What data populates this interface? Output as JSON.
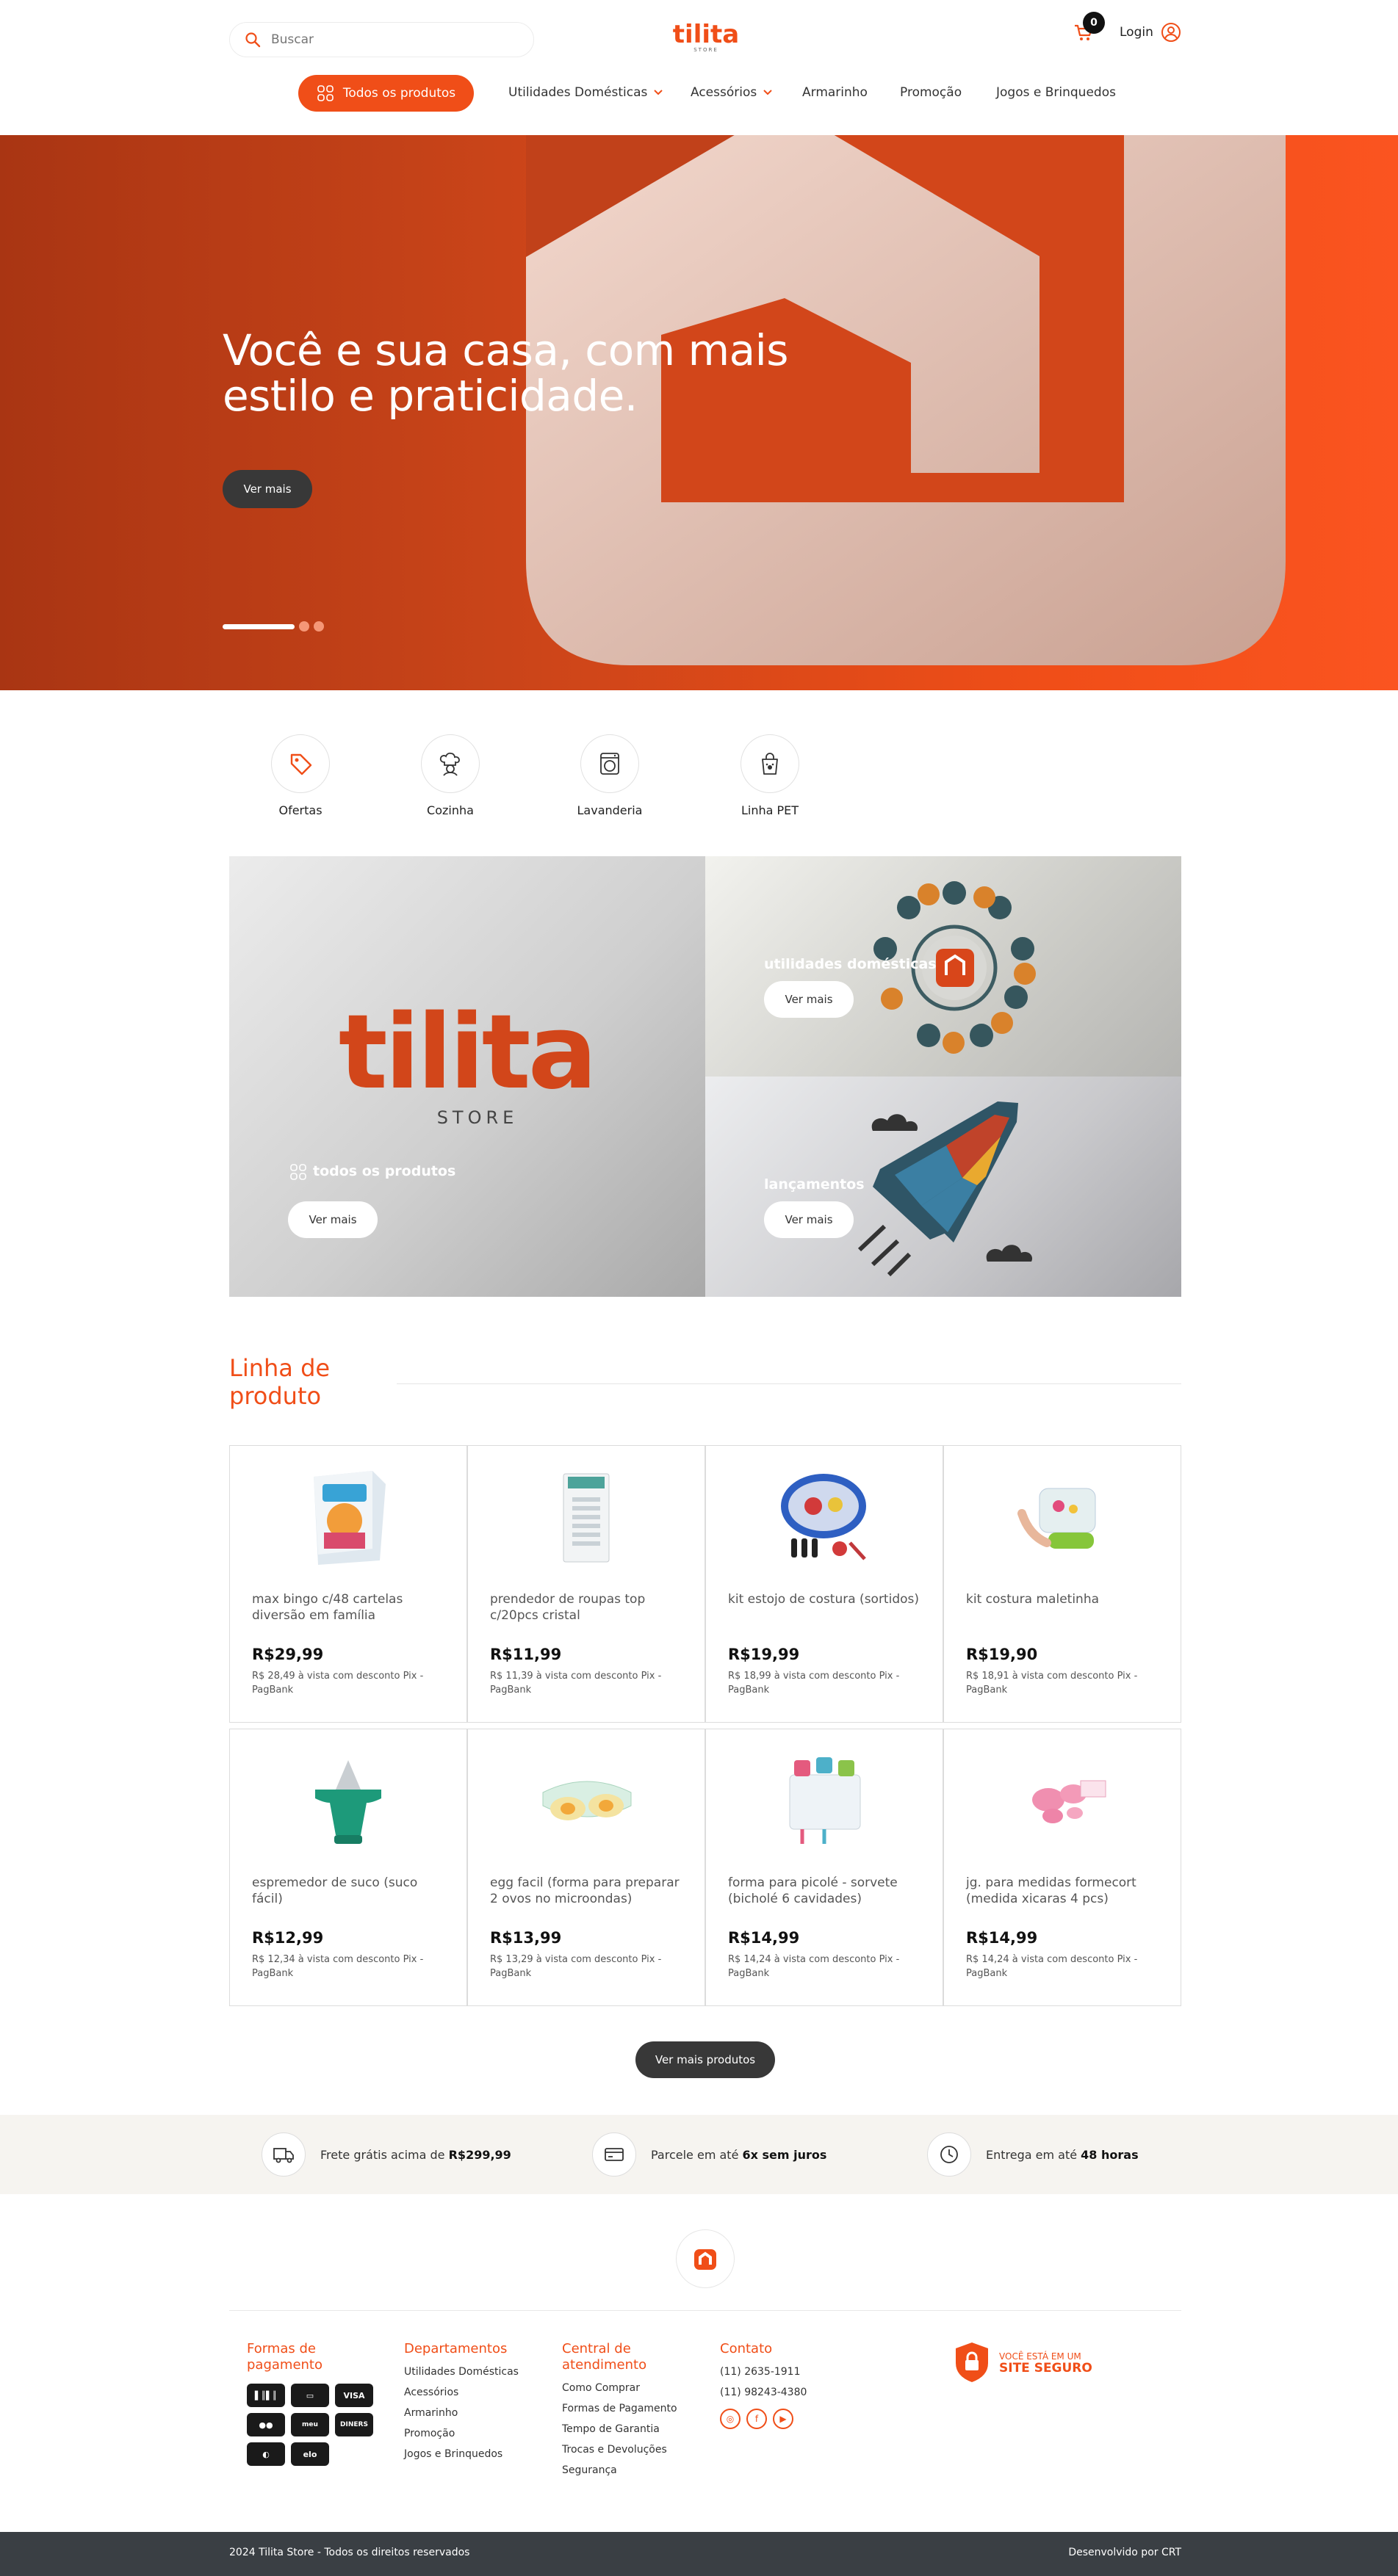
{
  "header": {
    "search_placeholder": "Buscar",
    "cart_count": "0",
    "login_label": "Login"
  },
  "nav": {
    "all_products": "Todos os produtos",
    "items": [
      "Utilidades Domésticas",
      "Acessórios",
      "Armarinho",
      "Promoção",
      "Jogos e Brinquedos"
    ]
  },
  "hero": {
    "title_line1": "Você e sua casa, com mais",
    "title_line2": "estilo e praticidade.",
    "button": "Ver mais"
  },
  "categories": [
    "Ofertas",
    "Cozinha",
    "Lavanderia",
    "Linha PET"
  ],
  "banners": {
    "logo_word": "tilita",
    "logo_sub": "STORE",
    "all_label": "todos os produtos",
    "utilities_label": "utilidades domésticas",
    "launches_label": "lançamentos",
    "button": "Ver mais"
  },
  "product_line": {
    "title_line1": "Linha de",
    "title_line2": "produto",
    "products": [
      {
        "name": "max bingo c/48 cartelas diversão em família",
        "price": "R$29,99",
        "pix": "R$ 28,49 à vista com desconto Pix - PagBank"
      },
      {
        "name": "prendedor de roupas top c/20pcs cristal",
        "price": "R$11,99",
        "pix": "R$ 11,39 à vista com desconto Pix - PagBank"
      },
      {
        "name": "kit estojo de costura (sortidos)",
        "price": "R$19,99",
        "pix": "R$ 18,99 à vista com desconto Pix - PagBank"
      },
      {
        "name": "kit costura maletinha",
        "price": "R$19,90",
        "pix": "R$ 18,91 à vista com desconto Pix - PagBank"
      },
      {
        "name": "espremedor de suco (suco fácil)",
        "price": "R$12,99",
        "pix": "R$ 12,34 à vista com desconto Pix - PagBank"
      },
      {
        "name": "egg facil (forma para preparar 2 ovos no microondas)",
        "price": "R$13,99",
        "pix": "R$ 13,29 à vista com desconto Pix - PagBank"
      },
      {
        "name": "forma para picolé - sorvete (bicholé 6 cavidades)",
        "price": "R$14,99",
        "pix": "R$ 14,24 à vista com desconto Pix - PagBank"
      },
      {
        "name": "jg. para medidas formecort (medida xicaras 4 pcs)",
        "price": "R$14,99",
        "pix": "R$ 14,24 à vista com desconto Pix - PagBank"
      }
    ],
    "more_button": "Ver mais produtos"
  },
  "benefits": {
    "shipping_text": "Frete grátis acima de ",
    "shipping_value": "R$299,99",
    "installments_text": "Parcele em até ",
    "installments_value": "6x sem juros",
    "delivery_text": "Entrega em até ",
    "delivery_value": "48 horas"
  },
  "footer": {
    "payment_title": "Formas de pagamento",
    "payment_methods": [
      "BOLETO",
      "CARD",
      "VISA",
      "MC",
      "meu carrinho",
      "DINERS",
      "AMEX",
      "elo"
    ],
    "departments_title": "Departamentos",
    "departments": [
      "Utilidades Domésticas",
      "Acessórios",
      "Armarinho",
      "Promoção",
      "Jogos e Brinquedos"
    ],
    "service_title": "Central de atendimento",
    "service_links": [
      "Como Comprar",
      "Formas de Pagamento",
      "Tempo de Garantia",
      "Trocas e Devoluções",
      "Segurança"
    ],
    "contact_title": "Contato",
    "phones": [
      "(11) 2635-1911",
      "(11) 98243-4380"
    ],
    "safe_small": "VOCÊ ESTÁ EM UM",
    "safe_big": "SITE SEGURO",
    "copyright": "2024 Tilita Store - Todos os direitos reservados",
    "developed_by": "Desenvolvido por CRT"
  },
  "colors": {
    "accent": "#f04e18",
    "dark": "#383838",
    "footer_bar": "#3a3f44"
  }
}
